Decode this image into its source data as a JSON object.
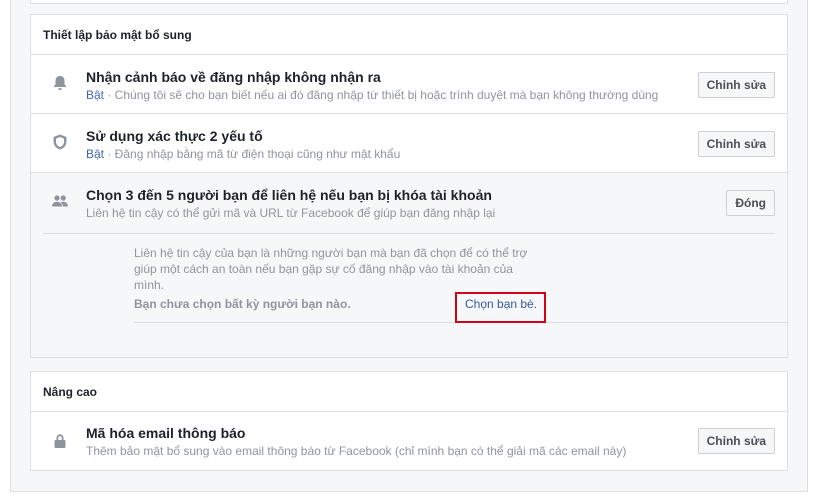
{
  "extra_security": {
    "header": "Thiết lập bảo mật bổ sung",
    "alerts": {
      "title": "Nhận cảnh báo về đăng nhập không nhận ra",
      "status": "Bật",
      "detail": " · Chúng tôi sẽ cho bạn biết nếu ai đó đăng nhập từ thiết bị hoặc trình duyệt mà bạn không thường dùng",
      "button": "Chỉnh sửa",
      "icon": "bell-icon"
    },
    "two_factor": {
      "title": "Sử dụng xác thực 2 yếu tố",
      "status": "Bật",
      "detail": " · Đăng nhập bằng mã từ điện thoại cũng như mật khẩu",
      "button": "Chỉnh sửa",
      "icon": "shield-icon"
    },
    "trusted_contacts": {
      "title": "Chọn 3 đến 5 người bạn để liên hệ nếu bạn bị khóa tài khoản",
      "subtitle": "Liên hệ tin cậy có thể gửi mã và URL từ Facebook để giúp bạn đăng nhập lại",
      "button": "Đóng",
      "icon": "friends-icon",
      "description": "Liên hệ tin cậy của bạn là những người bạn mà bạn đã chọn để có thể trợ giúp một cách an toàn nếu bạn gặp sự cố đăng nhập vào tài khoản của mình.",
      "none_selected": "Bạn chưa chọn bất kỳ người bạn nào.",
      "choose_link": "Chọn bạn bè."
    }
  },
  "advanced": {
    "header": "Nâng cao",
    "encrypted_email": {
      "title": "Mã hóa email thông báo",
      "subtitle": "Thêm bảo mật bổ sung vào email thông báo từ Facebook (chỉ mình bạn có thể giải mã các email này)",
      "button": "Chỉnh sửa",
      "icon": "lock-icon"
    }
  },
  "colors": {
    "link": "#365899",
    "status_on": "#4267b2",
    "highlight": "#d0021b"
  }
}
